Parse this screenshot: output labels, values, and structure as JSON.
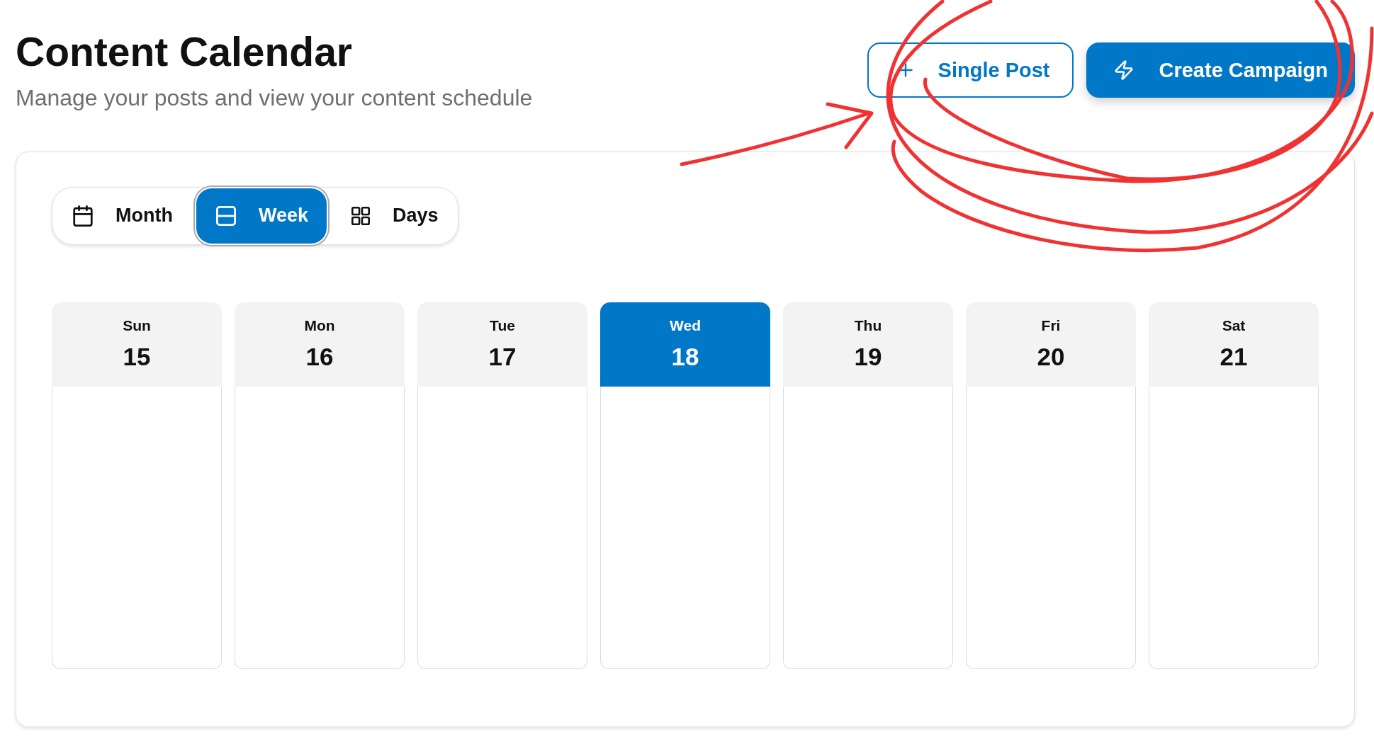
{
  "header": {
    "title": "Content Calendar",
    "subtitle": "Manage your posts and view your content schedule"
  },
  "actions": [
    {
      "label": "Single Post",
      "kind": "outline"
    },
    {
      "label": "Create Campaign",
      "kind": "filled"
    }
  ],
  "view_modes": [
    {
      "label": "Month",
      "selected": false
    },
    {
      "label": "Week",
      "selected": true
    },
    {
      "label": "Days",
      "selected": false
    }
  ],
  "week": [
    {
      "day": "Sun",
      "date": "15",
      "selected": false
    },
    {
      "day": "Mon",
      "date": "16",
      "selected": false
    },
    {
      "day": "Tue",
      "date": "17",
      "selected": false
    },
    {
      "day": "Wed",
      "date": "18",
      "selected": true
    },
    {
      "day": "Thu",
      "date": "19",
      "selected": false
    },
    {
      "day": "Fri",
      "date": "20",
      "selected": false
    },
    {
      "day": "Sat",
      "date": "21",
      "selected": false
    }
  ],
  "annotations": [
    {
      "kind": "arrow"
    },
    {
      "kind": "circle"
    }
  ]
}
